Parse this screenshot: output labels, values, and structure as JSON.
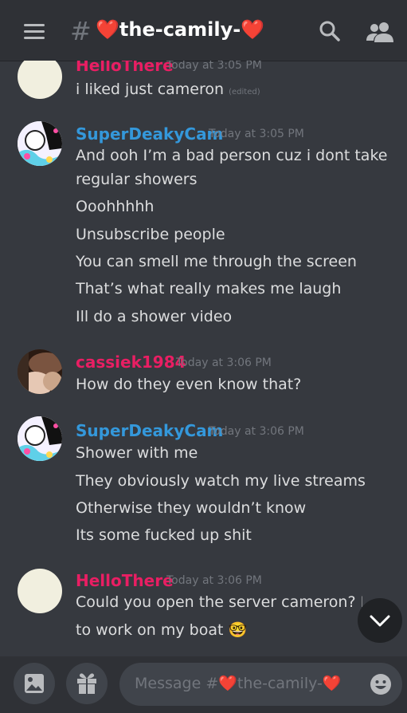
{
  "header": {
    "hash": "#",
    "heart_left": "❤️",
    "channel_name": "the-camily-",
    "heart_right": "❤️"
  },
  "messages": [
    {
      "username": "HelloThere",
      "timestamp": "Today at 3:05 PM",
      "lines": [
        "i liked just cameron"
      ],
      "edited_label": "(edited)",
      "color": "#e91e63"
    },
    {
      "username": "SuperDeakyCam",
      "timestamp": "Today at 3:05 PM",
      "lines": [
        "And ooh I’m a bad person cuz i dont take",
        "regular showers",
        "Ooohhhhh",
        "Unsubscribe people",
        "You can smell me through the screen",
        "That’s what really makes me laugh",
        "Ill do a shower video"
      ],
      "color": "#3498db"
    },
    {
      "username": "cassiek1984",
      "timestamp": "Today at 3:06 PM",
      "lines": [
        "How do they even know that?"
      ],
      "color": "#e91e63"
    },
    {
      "username": "SuperDeakyCam",
      "timestamp": "Today at 3:06 PM",
      "lines": [
        "Shower with me",
        "They obviously watch my live streams",
        "Otherwise they wouldn’t know",
        "Its some fucked up shit"
      ],
      "color": "#3498db"
    },
    {
      "username": "HelloThere",
      "timestamp": "Today at 3:06 PM",
      "lines": [
        "Could you open the server cameron? I w",
        "to work on my boat"
      ],
      "emoji": "🤓",
      "color": "#e91e63"
    }
  ],
  "composer": {
    "placeholder_prefix": "Message #",
    "placeholder_channel": "the-camily-",
    "heart": "❤️"
  },
  "icons": [
    "menu-icon",
    "hash-icon",
    "search-icon",
    "members-icon",
    "image-icon",
    "gift-icon",
    "emoji-icon",
    "chevron-down-icon"
  ]
}
